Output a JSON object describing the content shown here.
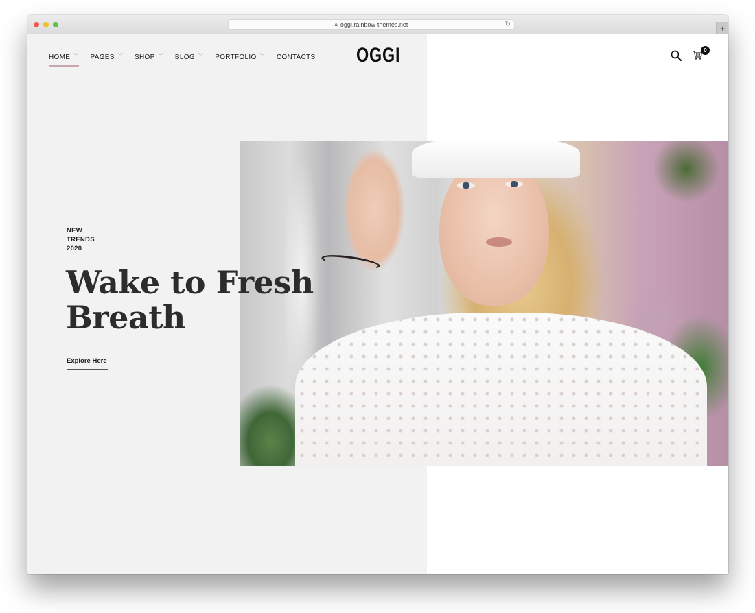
{
  "browser": {
    "url": "oggi.rainbow-themes.net",
    "lock_icon": "lock-icon",
    "reload_icon": "reload-icon",
    "new_tab_label": "+"
  },
  "header": {
    "logo": "OGGI",
    "nav": [
      {
        "label": "HOME",
        "has_dropdown": true,
        "active": true
      },
      {
        "label": "PAGES",
        "has_dropdown": true,
        "active": false
      },
      {
        "label": "SHOP",
        "has_dropdown": true,
        "active": false
      },
      {
        "label": "BLOG",
        "has_dropdown": true,
        "active": false
      },
      {
        "label": "PORTFOLIO",
        "has_dropdown": true,
        "active": false
      },
      {
        "label": "CONTACTS",
        "has_dropdown": false,
        "active": false
      }
    ],
    "chevron_glyph": "﹀",
    "search_icon": "search-icon",
    "cart_icon": "cart-icon",
    "cart_count": "0"
  },
  "hero": {
    "eyebrow_lines": [
      "NEW",
      "TRENDS",
      "2020"
    ],
    "headline_lines": [
      "Wake to Fresh",
      "Breath"
    ],
    "cta_label": "Explore Here",
    "image_alt": "Woman in white cap and white lace blouse"
  },
  "colors": {
    "left_panel": "#f2f2f2",
    "right_panel": "#ffffff",
    "active_underline": "#c9a7ad",
    "text": "#1e1e1e",
    "headline": "#2c2c2c"
  }
}
